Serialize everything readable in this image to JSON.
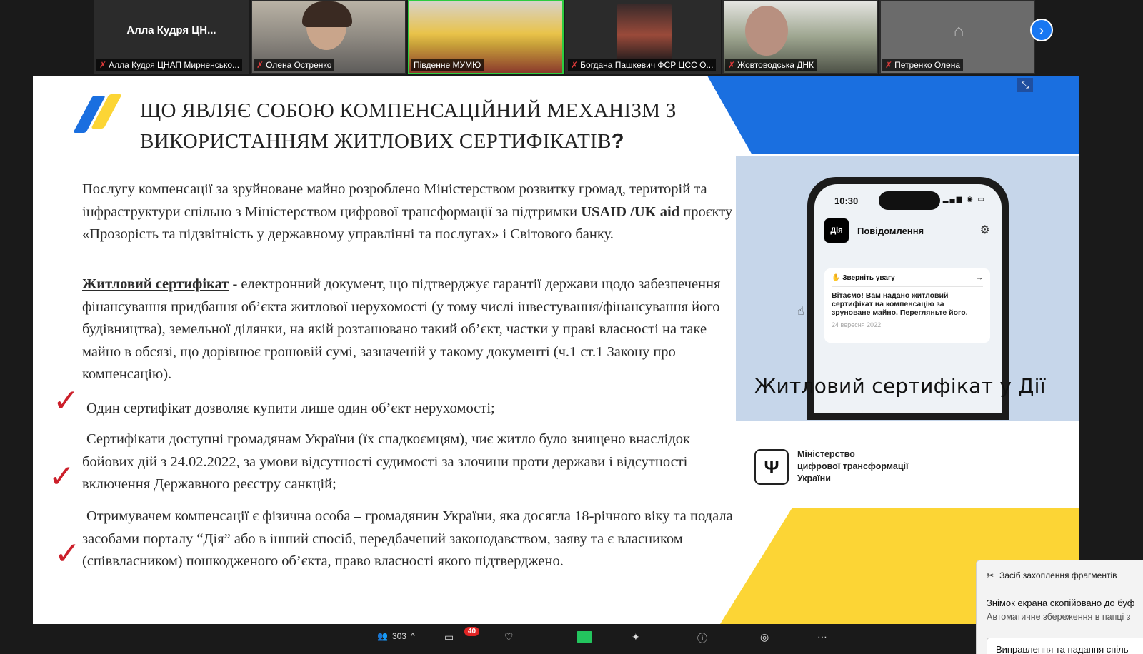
{
  "participants": [
    {
      "name_display": "Алла Кудря ЦН...",
      "label": "Алла Кудря ЦНАП Мирненсько...",
      "muted": true
    },
    {
      "label": "Олена Остренко",
      "muted": true
    },
    {
      "label": "Південне МУМЮ",
      "muted": false,
      "active": true
    },
    {
      "label": "Богдана Пашкевич ФСР ЦСС О...",
      "muted": true
    },
    {
      "label": "Жовтоводська ДНК",
      "muted": true
    },
    {
      "label": "Петренко Олена",
      "muted": true
    }
  ],
  "slide": {
    "title_line1": "ЩО ЯВЛЯЄ СОБОЮ КОМПЕНСАЦІЙНИЙ МЕХАНІЗМ З",
    "title_line2": "ВИКОРИСТАННЯМ ЖИТЛОВИХ СЕРТИФІКАТІВ",
    "title_q": "?",
    "p1_a": "Послугу компенсації за зруйноване майно розроблено Міністерством розвитку громад, територій та інфраструктури спільно з Міністерством цифрової трансформації за підтримки ",
    "p1_bold": "USAID /UK aid",
    "p1_b": " проєкту «Прозорість та підзвітність у державному управлінні та послугах» і Світового банку.",
    "p2_term": "Житловий сертифікат",
    "p2_text": " - електронний документ, що підтверджує гарантії держави щодо забезпечення фінансування придбання об’єкта житлової нерухомості (у тому числі інвестування/фінансування його будівництва), земельної ділянки, на якій розташовано такий об’єкт, частки у праві власності на таке майно в обсязі, що дорівнює грошовій сумі, зазначеній у такому документі (ч.1 ст.1 Закону про компенсацію).",
    "bullet1": "Один сертифікат дозволяє купити лише один об’єкт нерухомості;",
    "bullet2": "Сертифікати доступні громадянам України (їх спадкоємцям), чиє житло було знищено внаслідок бойових дій з 24.02.2022, за умови відсутності судимості за злочини проти держави і відсутності включення Державного реєстру санкцій;",
    "bullet3": "Отримувачем компенсації є фізична особа – громадянин України, яка досягла 18-річного віку та подала засобами порталу “Дія” або в інший спосіб, передбачений законодавством, заяву та є власником (співвласником) пошкодженого об’єкта, право власності якого підтверджено.",
    "check_mark": "✓"
  },
  "phone": {
    "time": "10:30",
    "app_badge": "Дія",
    "header": "Повідомлення",
    "card_title": "Зверніть увагу",
    "card_body": "Вітаємо! Вам надано житловий сертифікат на компенсацію за зруноване майно. Перегляньте його.",
    "card_date": "24 вересня 2022",
    "caption": "Житловий сертифікат у Дії"
  },
  "ministry": {
    "line1": "Міністерство",
    "line2": "цифрової трансформації",
    "line3": "України"
  },
  "toolbar": {
    "participants_count": "303",
    "chat_badge": "40"
  },
  "toast": {
    "app": "Засіб захоплення фрагментів",
    "message": "Знімок екрана скопійовано до буф",
    "sub": "Автоматичне збереження в папці з",
    "button": "Виправлення та надання спіль"
  },
  "colors": {
    "brand_blue": "#1a6fe0",
    "brand_yellow": "#fcd535",
    "check_red": "#cc1f2a",
    "active_border": "#2ecc40"
  }
}
